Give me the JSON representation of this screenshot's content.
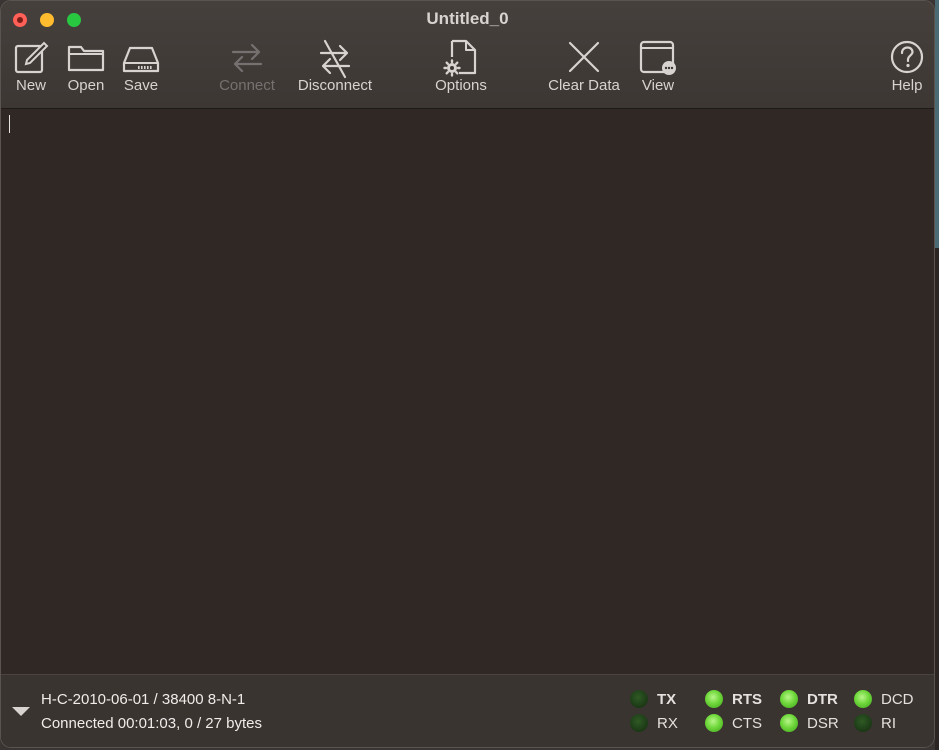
{
  "window": {
    "title": "Untitled_0"
  },
  "toolbar": {
    "items": [
      {
        "label": "New",
        "icon": "new-document-icon",
        "enabled": true
      },
      {
        "label": "Open",
        "icon": "folder-icon",
        "enabled": true
      },
      {
        "label": "Save",
        "icon": "disk-drive-icon",
        "enabled": true
      },
      {
        "label": "Connect",
        "icon": "connect-arrows-icon",
        "enabled": false
      },
      {
        "label": "Disconnect",
        "icon": "disconnect-arrows-icon",
        "enabled": true
      },
      {
        "label": "Options",
        "icon": "document-gear-icon",
        "enabled": true
      },
      {
        "label": "Clear Data",
        "icon": "x-mark-icon",
        "enabled": true
      },
      {
        "label": "View",
        "icon": "window-more-icon",
        "enabled": true
      },
      {
        "label": "Help",
        "icon": "question-circle-icon",
        "enabled": true
      }
    ]
  },
  "status": {
    "port_settings": "H-C-2010-06-01 / 38400 8-N-1",
    "connection": "Connected 00:01:03, 0 / 27 bytes"
  },
  "signals": [
    {
      "label": "TX",
      "state": "off",
      "bold": true
    },
    {
      "label": "RX",
      "state": "off",
      "bold": false
    },
    {
      "label": "RTS",
      "state": "on",
      "bold": true
    },
    {
      "label": "CTS",
      "state": "on",
      "bold": false
    },
    {
      "label": "DTR",
      "state": "on",
      "bold": true
    },
    {
      "label": "DSR",
      "state": "on",
      "bold": false
    },
    {
      "label": "DCD",
      "state": "on",
      "bold": false
    },
    {
      "label": "RI",
      "state": "off",
      "bold": false
    }
  ],
  "colors": {
    "led_on": "#6fd83b",
    "led_off": "#1e3d18",
    "close": "#fe5f57",
    "minimize": "#febc2e",
    "maximize": "#28c840"
  }
}
